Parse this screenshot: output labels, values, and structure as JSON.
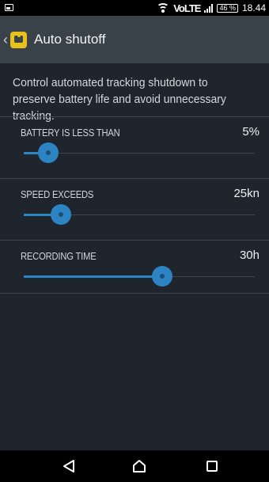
{
  "status_bar": {
    "network_label": "VoLTE",
    "battery_label": "46 %",
    "time": "18.44"
  },
  "app_bar": {
    "title": "Auto shutoff"
  },
  "description": "Control automated tracking shutdown to preserve battery life and avoid unnecessary tracking.",
  "settings": [
    {
      "label": "BATTERY IS LESS THAN",
      "value": "5%",
      "level": 0.105
    },
    {
      "label": "SPEED EXCEEDS",
      "value": "25kn",
      "level": 0.16
    },
    {
      "label": "RECORDING TIME",
      "value": "30h",
      "level": 0.6
    }
  ],
  "colors": {
    "accent": "#2c84c2",
    "background": "#1e252c",
    "app_bar": "#3a4249",
    "logo": "#e8c21a"
  },
  "icons": {
    "status_left": "image-icon",
    "wifi": "wifi-icon",
    "signal": "signal-icon",
    "battery": "battery-icon",
    "back_chevron": "chevron-left-icon",
    "logo": "app-logo-icon",
    "nav_back": "nav-back-icon",
    "nav_home": "nav-home-icon",
    "nav_recent": "nav-recent-icon"
  }
}
